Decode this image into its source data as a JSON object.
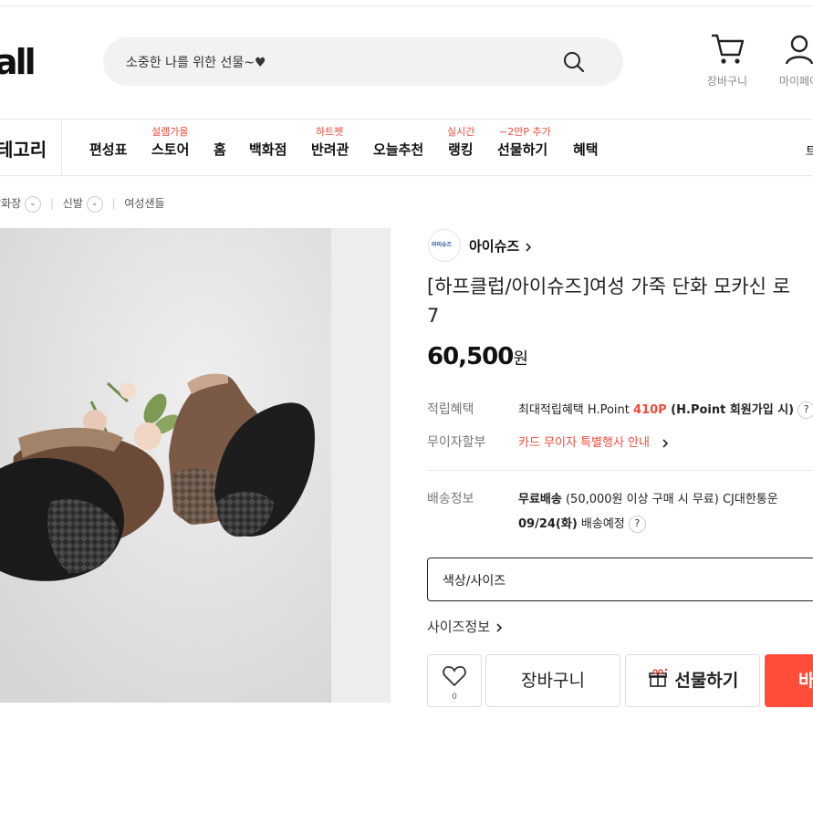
{
  "header": {
    "logo_text": "all",
    "search_placeholder": "소중한 나를 위한 선물~♥",
    "cart_label": "장바구니",
    "mypage_label": "마이페이"
  },
  "nav": {
    "category_label": "테고리",
    "items": [
      {
        "label": "편성표",
        "badge": ""
      },
      {
        "label": "스토어",
        "badge": "설렘가을"
      },
      {
        "label": "홈",
        "badge": ""
      },
      {
        "label": "백화점",
        "badge": ""
      },
      {
        "label": "반려관",
        "badge": "하트펫"
      },
      {
        "label": "오늘추천",
        "badge": ""
      },
      {
        "label": "랭킹",
        "badge": "실시간"
      },
      {
        "label": "선물하기",
        "badge": "~2만P 추가"
      },
      {
        "label": "혜택",
        "badge": ""
      }
    ],
    "right_edge_text": "트"
  },
  "breadcrumb": {
    "items": [
      "패션잡화장",
      "신발",
      "여성샌들"
    ]
  },
  "product": {
    "brand_logo_text": "아이슈즈",
    "brand_name": "아이슈즈",
    "title_line1": "[하프클럽/아이슈즈]여성 가죽 단화 모카신 로",
    "title_line2": "7",
    "price": "60,500",
    "price_unit": "원",
    "rewards_label": "적립혜택",
    "rewards_prefix": "최대적립혜택 H.Point ",
    "rewards_points": "410P",
    "rewards_suffix": " (H.Point 회원가입 시)",
    "installment_label": "무이자할부",
    "installment_value": "카드 무이자 특별행사 안내",
    "shipping_label": "배송정보",
    "shipping_free": "무료배송",
    "shipping_detail": " (50,000원 이상 구매 시 무료) CJ대한통운",
    "shipping_date": "09/24(화)",
    "shipping_date_suffix": " 배송예정",
    "option_select": "색상/사이즈",
    "size_info": "사이즈정보",
    "like_count": "0",
    "cart_button": "장바구니",
    "gift_button": "선물하기",
    "buy_button": "바"
  },
  "colors": {
    "accent_red": "#ee4b3b",
    "buy_button": "#ff4d3a"
  },
  "icons": [
    "search-icon",
    "cart-icon",
    "user-icon",
    "chevron-down-icon",
    "chevron-right-icon",
    "heart-icon",
    "gift-icon",
    "question-icon"
  ]
}
